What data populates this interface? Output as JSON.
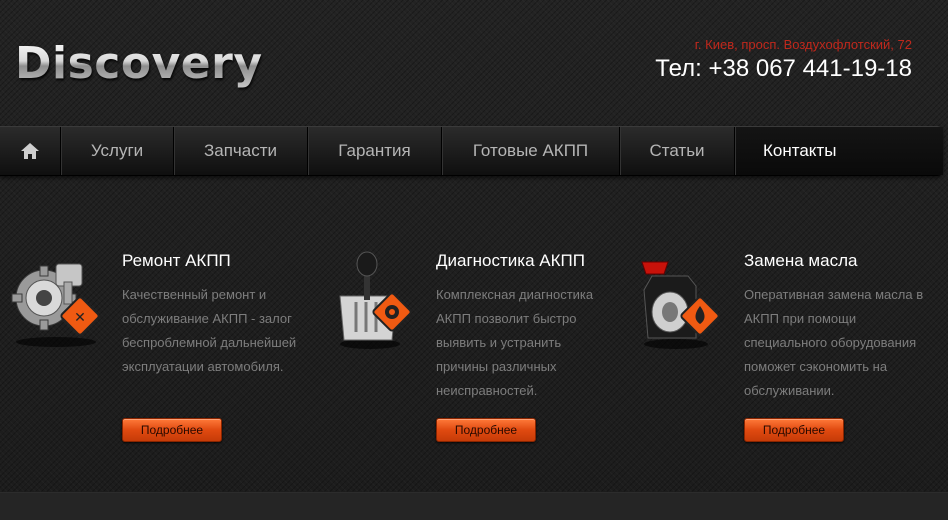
{
  "header": {
    "logo": "Discovery",
    "address": "г. Киев, просп. Воздухофлотский, 72",
    "phone": "Тел: +38 067 441-19-18"
  },
  "nav": {
    "items": [
      {
        "label": "Услуги"
      },
      {
        "label": "Запчасти"
      },
      {
        "label": "Гарантия"
      },
      {
        "label": "Готовые АКПП"
      },
      {
        "label": "Статьи"
      },
      {
        "label": "Контакты"
      }
    ]
  },
  "services": [
    {
      "title": "Ремонт АКПП",
      "text": "Качественный ремонт и обслуживание АКПП - залог беспроблемной дальнейшей эксплуатации автомобиля.",
      "button": "Подробнее"
    },
    {
      "title": "Диагностика АКПП",
      "text": "Комплексная диагностика АКПП позволит быстро выявить и устранить причины различных неисправностей.",
      "button": "Подробнее"
    },
    {
      "title": "Замена масла",
      "text": "Оперативная замена масла в АКПП при помощи специального оборудования поможет сэкономить на обслуживании.",
      "button": "Подробнее"
    }
  ],
  "colors": {
    "accent": "#e04a10",
    "address": "#c0281c",
    "body_text": "#7d7d7d"
  }
}
